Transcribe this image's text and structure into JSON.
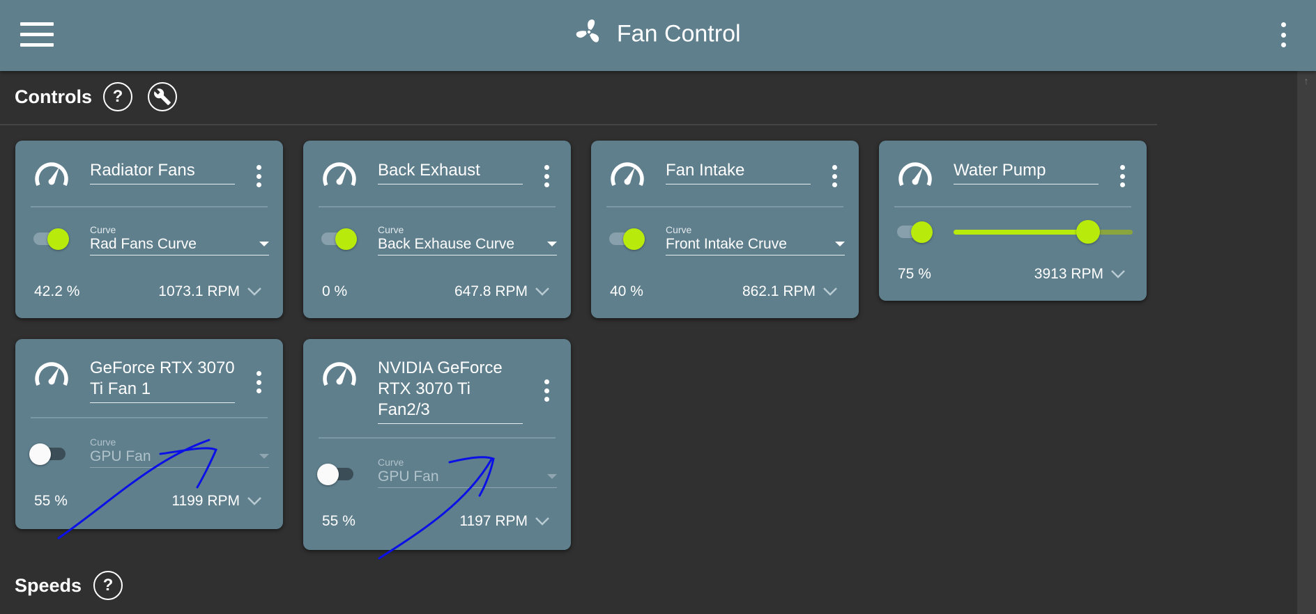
{
  "app": {
    "title": "Fan Control"
  },
  "sections": {
    "controls": "Controls",
    "speeds": "Speeds",
    "help_glyph": "?"
  },
  "colors": {
    "appbar": "#5f7f8d",
    "card": "#5f7f8d",
    "accent": "#b8eb0b",
    "background": "#303030"
  },
  "cards": [
    {
      "name": "Radiator Fans",
      "mode": "curve",
      "enabled": true,
      "curve_label": "Curve",
      "curve": "Rad Fans Curve",
      "percent": "42.2 %",
      "rpm": "1073.1 RPM"
    },
    {
      "name": "Back Exhaust",
      "mode": "curve",
      "enabled": true,
      "curve_label": "Curve",
      "curve": "Back Exhause Curve",
      "percent": "0 %",
      "rpm": "647.8 RPM"
    },
    {
      "name": "Fan Intake",
      "mode": "curve",
      "enabled": true,
      "curve_label": "Curve",
      "curve": "Front Intake Cruve",
      "percent": "40 %",
      "rpm": "862.1 RPM"
    },
    {
      "name": "Water Pump",
      "mode": "manual",
      "enabled": true,
      "slider_value": 75,
      "percent": "75 %",
      "rpm": "3913 RPM"
    },
    {
      "name": "GeForce RTX 3070 Ti Fan 1",
      "mode": "curve",
      "enabled": false,
      "curve_label": "Curve",
      "curve": "GPU Fan",
      "percent": "55 %",
      "rpm": "1199 RPM"
    },
    {
      "name": "NVIDIA GeForce RTX 3070 Ti Fan2/3",
      "mode": "curve",
      "enabled": false,
      "curve_label": "Curve",
      "curve": "GPU Fan",
      "percent": "55 %",
      "rpm": "1197 RPM"
    }
  ]
}
